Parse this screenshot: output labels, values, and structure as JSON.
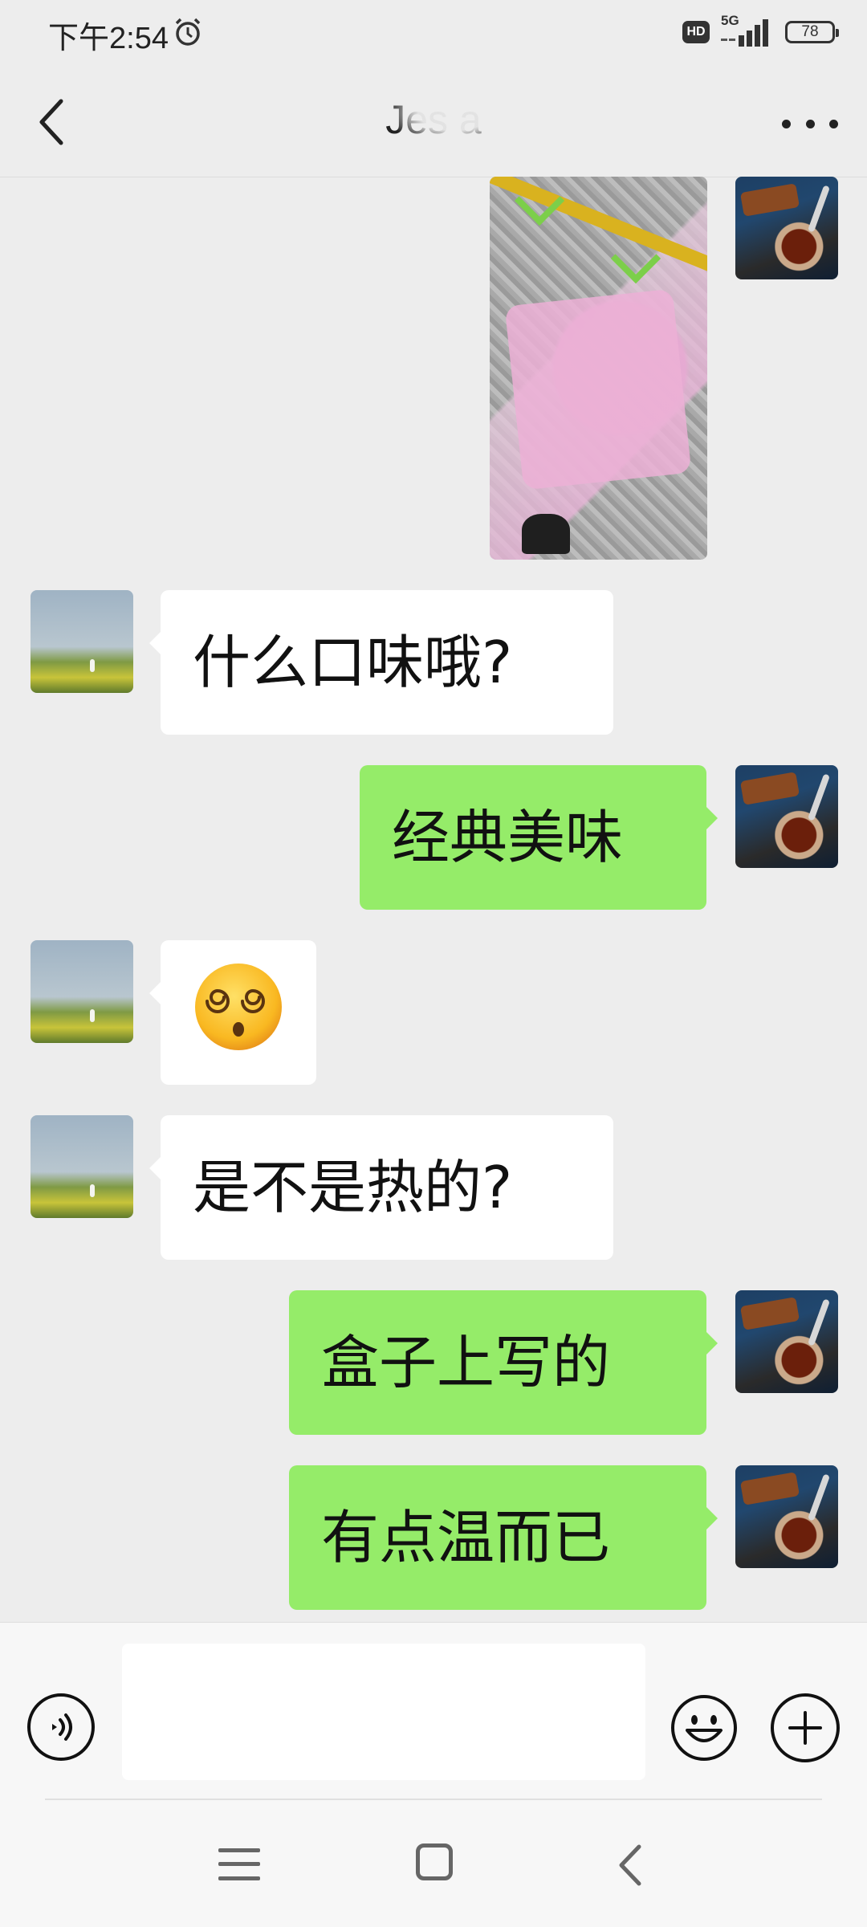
{
  "status_bar": {
    "time": "下午2:54",
    "hd_badge": "HD",
    "network": "5G",
    "battery": "78"
  },
  "header": {
    "title": "Jes  a"
  },
  "messages": [
    {
      "side": "out",
      "kind": "image"
    },
    {
      "side": "in",
      "kind": "text",
      "text": "什么口味哦?"
    },
    {
      "side": "out",
      "kind": "text",
      "text": "经典美味"
    },
    {
      "side": "in",
      "kind": "emoji",
      "text": "😵‍💫"
    },
    {
      "side": "in",
      "kind": "text",
      "text": "是不是热的?"
    },
    {
      "side": "out",
      "kind": "text",
      "text": "盒子上写的"
    },
    {
      "side": "out",
      "kind": "text",
      "text": "有点温而已"
    }
  ],
  "input_bar": {
    "placeholder": ""
  },
  "icons": {
    "alarm": "alarm-icon",
    "back": "back-arrow-icon",
    "more": "more-dots-icon",
    "voice": "voice-icon",
    "emoji": "emoji-icon",
    "plus": "plus-icon",
    "nav_menu": "menu-icon",
    "nav_home": "home-icon",
    "nav_back": "nav-back-icon"
  },
  "colors": {
    "background": "#ededed",
    "outgoing_bubble": "#95ec69",
    "incoming_bubble": "#ffffff"
  }
}
